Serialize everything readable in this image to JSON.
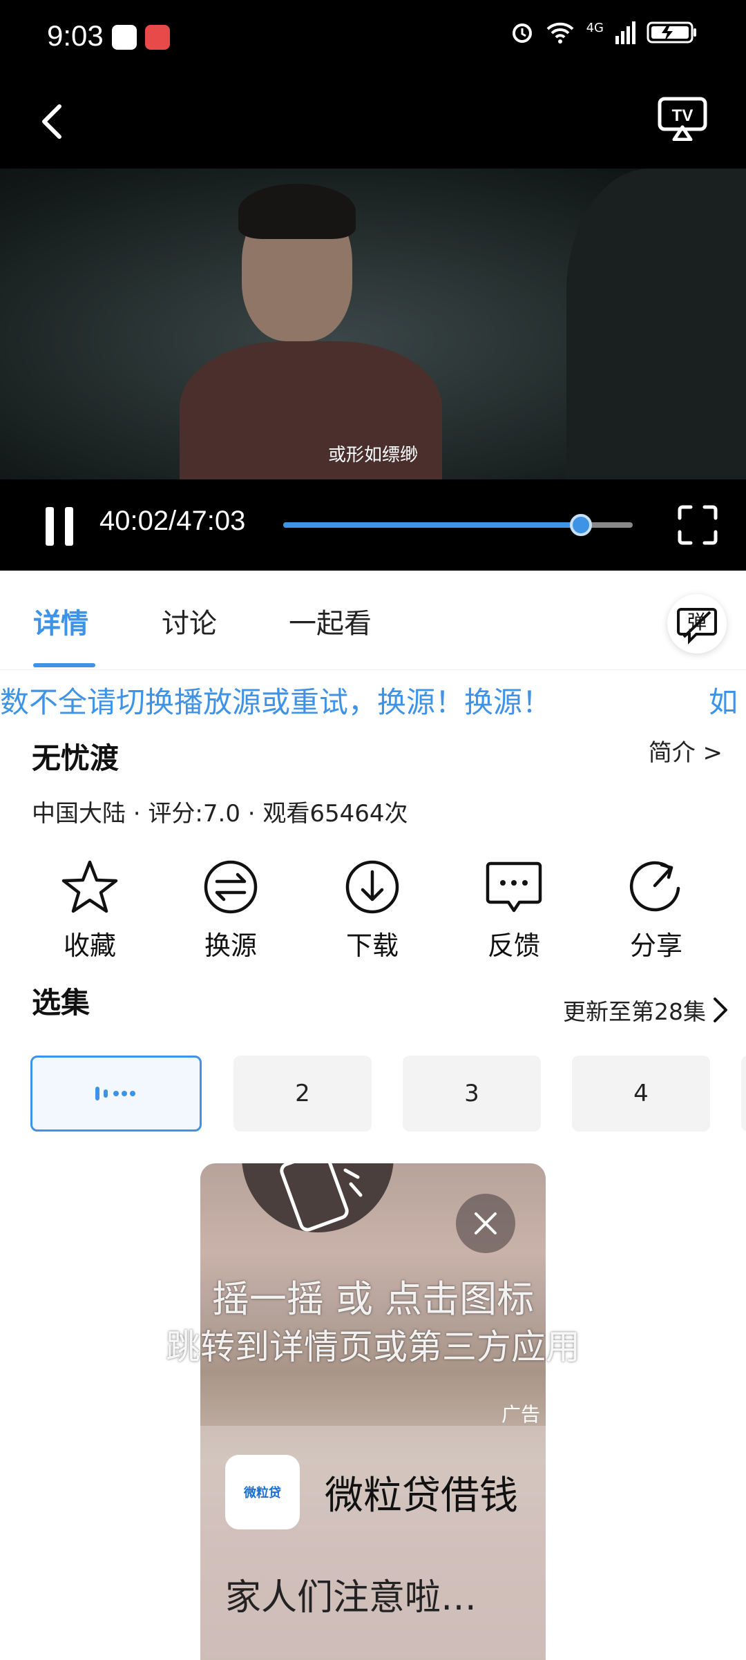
{
  "status_bar": {
    "time": "9:03",
    "network": "4G"
  },
  "player": {
    "subtitle": "或形如缥缈",
    "time_display": "40:02/47:03",
    "progress_fraction": 0.851
  },
  "tabs": [
    {
      "label": "详情",
      "active": true
    },
    {
      "label": "讨论",
      "active": false
    },
    {
      "label": "一起看",
      "active": false
    }
  ],
  "danmu_label": "弹",
  "marquee": {
    "text": "数不全请切换播放源或重试，换源！换源！",
    "text2": "如"
  },
  "detail": {
    "title": "无忧渡",
    "intro_link": "简介 >",
    "meta": "中国大陆 · 评分:7.0 · 观看65464次"
  },
  "actions": [
    {
      "label": "收藏",
      "icon": "star-icon"
    },
    {
      "label": "换源",
      "icon": "switch-source-icon"
    },
    {
      "label": "下载",
      "icon": "download-icon"
    },
    {
      "label": "反馈",
      "icon": "feedback-icon"
    },
    {
      "label": "分享",
      "icon": "share-icon"
    }
  ],
  "episodes_section": {
    "title": "选集",
    "update_text": "更新至第28集",
    "episodes": [
      "",
      "2",
      "3",
      "4"
    ]
  },
  "ad": {
    "shake_line1": "摇一摇 或 点击图标",
    "shake_line2": "跳转到详情页或第三方应用",
    "label": "广告",
    "app_name": "微粒贷借钱",
    "logo_text": "微粒贷",
    "description": "家人们注意啦…"
  },
  "colors": {
    "accent": "#3f93e6",
    "player_bg": "#000000"
  }
}
